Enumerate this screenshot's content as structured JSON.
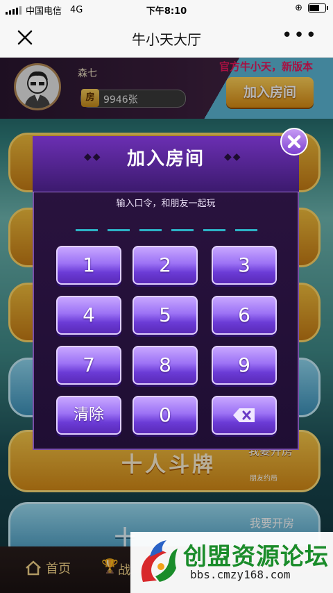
{
  "status_bar": {
    "carrier": "中国电信",
    "network": "4G",
    "time": "下午8:10",
    "battery_level": 0.7
  },
  "nav": {
    "title": "牛小天大厅"
  },
  "profile": {
    "name": "森七",
    "coin_tag": "房",
    "coins": "9946张"
  },
  "notice": "官方牛小天，新版本",
  "join_button": "加入房间",
  "dialog": {
    "title": "加入房间",
    "subtitle": "输入口令，和朋友一起玩",
    "keys": [
      "1",
      "2",
      "3",
      "4",
      "5",
      "6",
      "7",
      "8",
      "9",
      "清除",
      "0"
    ],
    "code_slots": 6
  },
  "game_cards": [
    {
      "title": "十人斗牌",
      "action": "我要开房",
      "sub": "朋友约局"
    },
    {
      "title": "十",
      "action": "我要开房"
    }
  ],
  "bottom_nav": {
    "home": "首页",
    "second": "战"
  },
  "watermark": {
    "title": "创盟资源论坛",
    "url": "bbs.cmzy168.com"
  },
  "colors": {
    "accent": "#7d3fd0",
    "notice": "#e8185c",
    "watermark_green": "#1a8c2a"
  }
}
